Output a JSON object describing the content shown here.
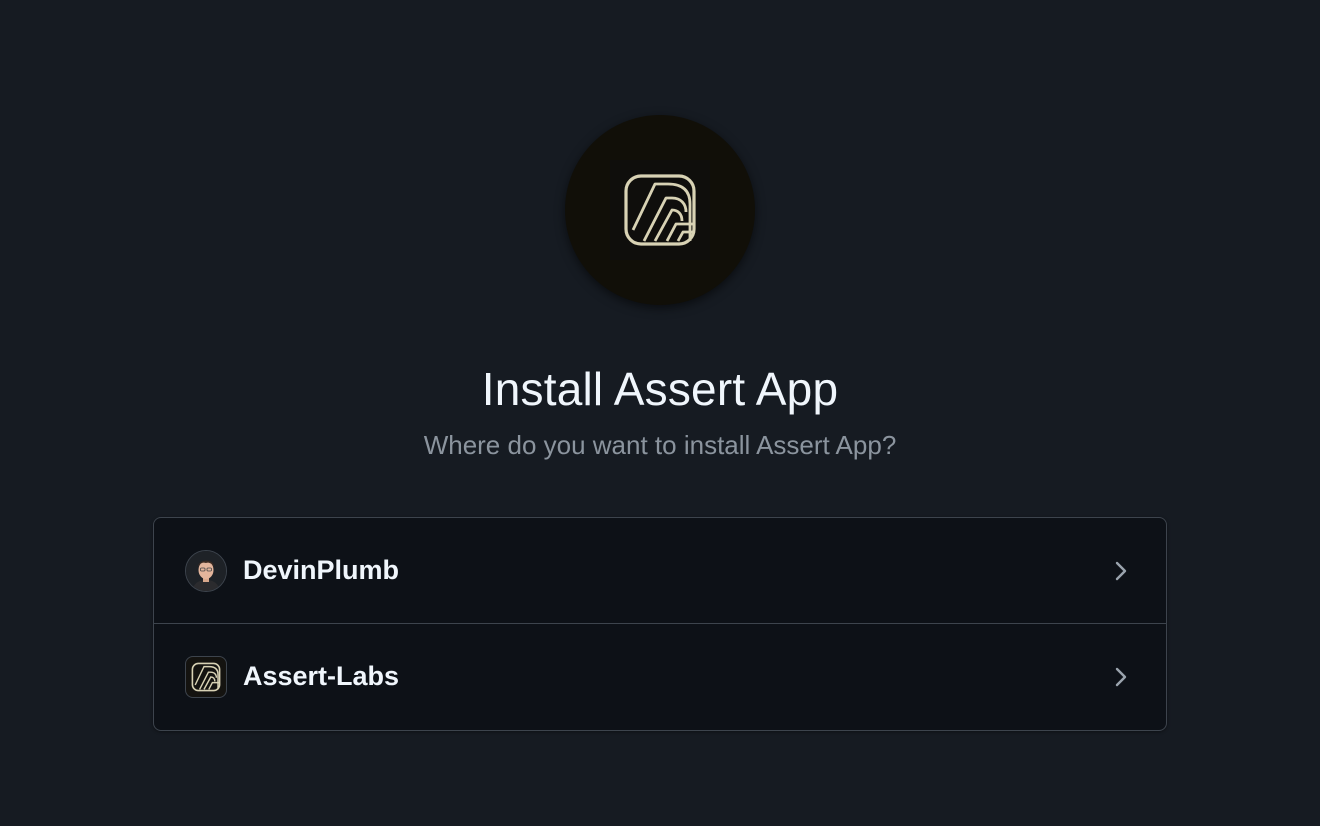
{
  "app": {
    "logo_icon": "assert-app-logo-icon",
    "logo_color": "#d8d2b4"
  },
  "header": {
    "title": "Install Assert App",
    "subtitle": "Where do you want to install Assert App?"
  },
  "targets": [
    {
      "name": "DevinPlumb",
      "type": "user",
      "icon": "user-avatar"
    },
    {
      "name": "Assert-Labs",
      "type": "organization",
      "icon": "assert-labs-org-logo-icon"
    }
  ],
  "colors": {
    "background": "#161b22",
    "card": "#0d1117",
    "border": "#3d444d",
    "muted_text": "#8b949e"
  }
}
